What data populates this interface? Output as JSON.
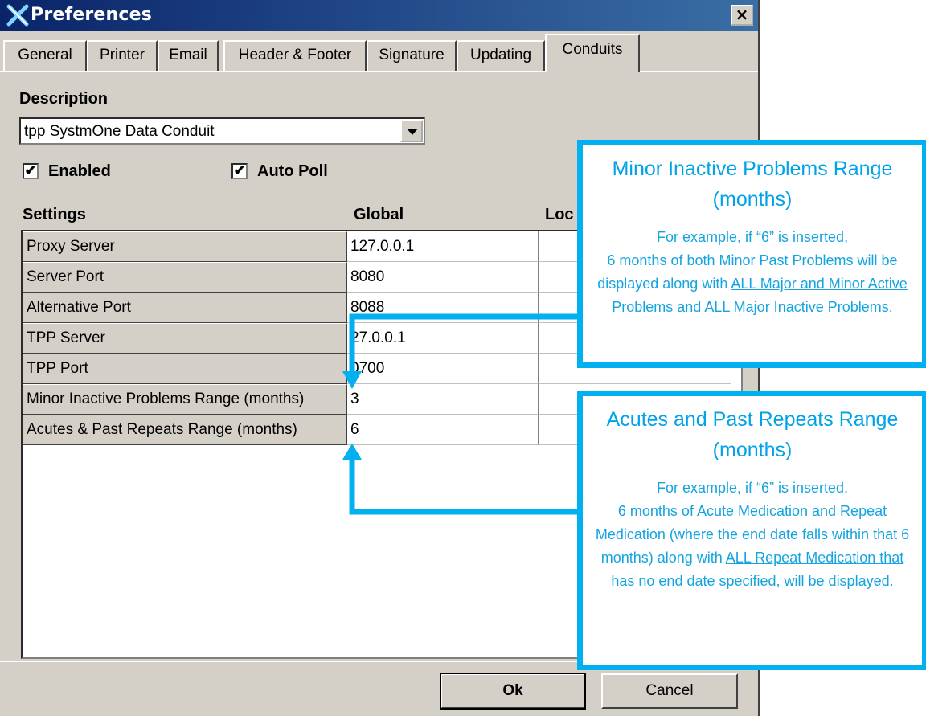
{
  "window": {
    "title": "Preferences",
    "close_label": "×",
    "accent_color": "#0a246a",
    "callout_color": "#00b0f0"
  },
  "tabs": [
    {
      "label": "General"
    },
    {
      "label": "Printer"
    },
    {
      "label": "Email"
    },
    {
      "label": "Header & Footer"
    },
    {
      "label": "Signature"
    },
    {
      "label": "Updating"
    },
    {
      "label": "Conduits",
      "active": true
    }
  ],
  "description": {
    "label": "Description",
    "selected": "tpp SystmOne Data Conduit"
  },
  "options": {
    "enabled_label": "Enabled",
    "enabled_checked": true,
    "autopoll_label": "Auto Poll",
    "autopoll_checked": true,
    "check_glyph": "✔"
  },
  "settings": {
    "header_settings": "Settings",
    "header_global": "Global",
    "header_local": "Loc",
    "rows": [
      {
        "label": "Proxy Server",
        "global": "127.0.0.1"
      },
      {
        "label": "Server Port",
        "global": "8080"
      },
      {
        "label": "Alternative Port",
        "global": "8088"
      },
      {
        "label": "TPP Server",
        "global": "27.0.0.1"
      },
      {
        "label": "TPP Port",
        "global": "0700"
      },
      {
        "label": "Minor Inactive Problems Range (months)",
        "global": "3"
      },
      {
        "label": "Acutes & Past Repeats Range (months)",
        "global": "6"
      }
    ]
  },
  "buttons": {
    "ok": "Ok",
    "cancel": "Cancel"
  },
  "callouts": {
    "minor": {
      "title": "Minor Inactive Problems Range (months)",
      "line1": "For example, if “6” is inserted,",
      "line2": "6 months of both Minor Past Problems will be displayed along with ",
      "underlined": "ALL Major and Minor Active Problems and ALL Major Inactive Problems."
    },
    "acutes": {
      "title": "Acutes and Past Repeats Range (months)",
      "line1": "For example, if “6” is inserted,",
      "line2": "6 months of Acute Medication and Repeat Medication (where the end date falls within that 6 months) along with ",
      "underlined": "ALL Repeat Medication that has no end date specified,",
      "line3": " will be displayed."
    }
  }
}
